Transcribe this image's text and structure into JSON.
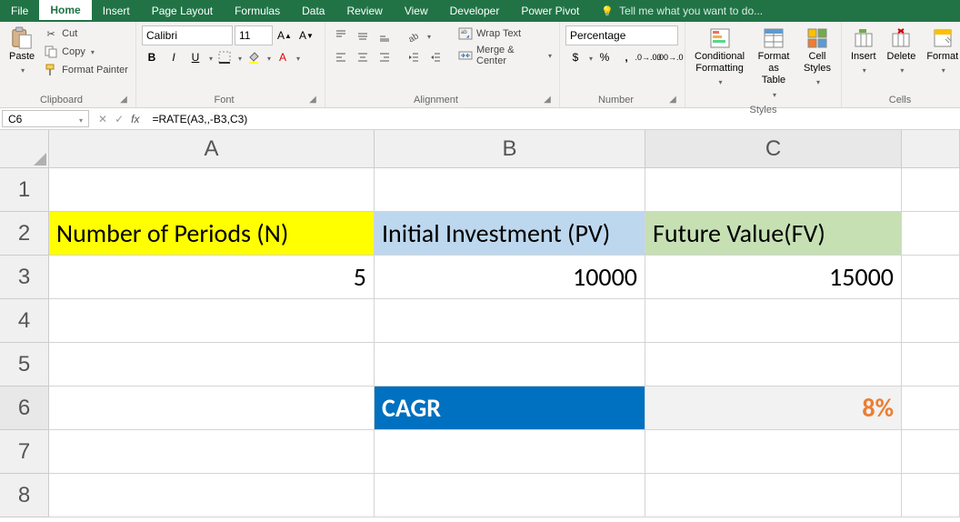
{
  "menu": {
    "file": "File",
    "home": "Home",
    "insert": "Insert",
    "page_layout": "Page Layout",
    "formulas": "Formulas",
    "data": "Data",
    "review": "Review",
    "view": "View",
    "developer": "Developer",
    "power_pivot": "Power Pivot",
    "tell_me": "Tell me what you want to do..."
  },
  "ribbon": {
    "clipboard": {
      "paste": "Paste",
      "cut": "Cut",
      "copy": "Copy",
      "format_painter": "Format Painter",
      "label": "Clipboard"
    },
    "font": {
      "name": "Calibri",
      "size": "11",
      "label": "Font"
    },
    "alignment": {
      "wrap": "Wrap Text",
      "merge": "Merge & Center",
      "label": "Alignment"
    },
    "number": {
      "format": "Percentage",
      "label": "Number"
    },
    "styles": {
      "conditional": "Conditional Formatting",
      "table": "Format as Table",
      "cell": "Cell Styles",
      "label": "Styles"
    },
    "cells": {
      "insert": "Insert",
      "delete": "Delete",
      "format": "Format",
      "label": "Cells"
    }
  },
  "formula_bar": {
    "name_box": "C6",
    "formula": "=RATE(A3,,-B3,C3)"
  },
  "sheet": {
    "cols": [
      "A",
      "B",
      "C"
    ],
    "rows": [
      "1",
      "2",
      "3",
      "4",
      "5",
      "6",
      "7",
      "8"
    ],
    "a2": "Number of Periods (N)",
    "b2": "Initial Investment (PV)",
    "c2": "Future Value(FV)",
    "a3": "5",
    "b3": "10000",
    "c3": "15000",
    "b6": "CAGR",
    "c6": "8%"
  }
}
